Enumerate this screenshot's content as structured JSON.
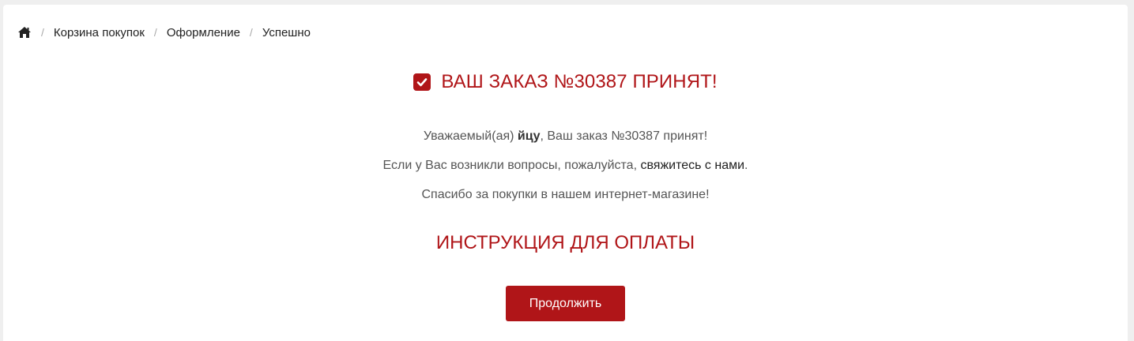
{
  "breadcrumb": {
    "home_icon": "home-icon",
    "separator": "/",
    "items": [
      {
        "label": "Корзина покупок"
      },
      {
        "label": "Оформление"
      },
      {
        "label": "Успешно"
      }
    ]
  },
  "confirmation": {
    "icon": "checked-square-icon",
    "title": "ВАШ ЗАКАЗ №30387 ПРИНЯТ!",
    "line1_prefix": "Уважаемый(ая) ",
    "customer_name": "йцу",
    "line1_suffix": ", Ваш заказ №30387 принят!",
    "line2_prefix": "Если у Вас возникли вопросы, пожалуйста, ",
    "contact_link": "свяжитесь с нами",
    "line2_suffix": ".",
    "line3": "Спасибо за покупки в нашем интернет-магазине!"
  },
  "payment": {
    "heading": "ИНСТРУКЦИЯ ДЛЯ ОПЛАТЫ"
  },
  "actions": {
    "continue_label": "Продолжить"
  },
  "colors": {
    "accent": "#b01518",
    "text": "#555555",
    "background": "#efefef"
  }
}
